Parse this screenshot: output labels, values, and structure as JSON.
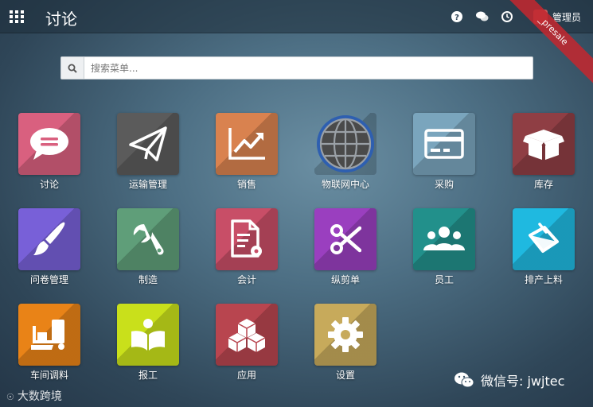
{
  "header": {
    "title": "讨论",
    "user_name": "管理员",
    "ribbon_text": "_presale"
  },
  "search": {
    "placeholder": "搜索菜单..."
  },
  "apps": [
    {
      "label": "讨论",
      "icon": "chat-icon",
      "color": "#d9607f"
    },
    {
      "label": "运输管理",
      "icon": "paper-plane-icon",
      "color": "#5b5b5b"
    },
    {
      "label": "销售",
      "icon": "trending-chart-icon",
      "color": "#d9824f"
    },
    {
      "label": "物联网中心",
      "icon": "globe-icon",
      "color": "#2a5da8"
    },
    {
      "label": "采购",
      "icon": "credit-card-icon",
      "color": "#7aa5bd"
    },
    {
      "label": "库存",
      "icon": "box-icon",
      "color": "#8f3e44"
    },
    {
      "label": "问卷管理",
      "icon": "paint-brush-icon",
      "color": "#7860d8"
    },
    {
      "label": "制造",
      "icon": "wrench-icon",
      "color": "#5f9e79"
    },
    {
      "label": "会计",
      "icon": "invoice-icon",
      "color": "#c84e67"
    },
    {
      "label": "纵剪单",
      "icon": "scissors-icon",
      "color": "#9a3fbf"
    },
    {
      "label": "员工",
      "icon": "users-icon",
      "color": "#22908b"
    },
    {
      "label": "排产上料",
      "icon": "paint-bucket-icon",
      "color": "#1fb9e0"
    },
    {
      "label": "车间调料",
      "icon": "forklift-icon",
      "color": "#e98317"
    },
    {
      "label": "报工",
      "icon": "reader-icon",
      "color": "#c9e01b"
    },
    {
      "label": "应用",
      "icon": "cubes-icon",
      "color": "#b8454f"
    },
    {
      "label": "设置",
      "icon": "gear-icon",
      "color": "#c7aa5b"
    }
  ],
  "watermarks": {
    "left": "大数跨境",
    "right": "微信号: jwjtec"
  },
  "colors": {
    "topbar": "#1e2d3a",
    "ribbon": "#c02830"
  }
}
